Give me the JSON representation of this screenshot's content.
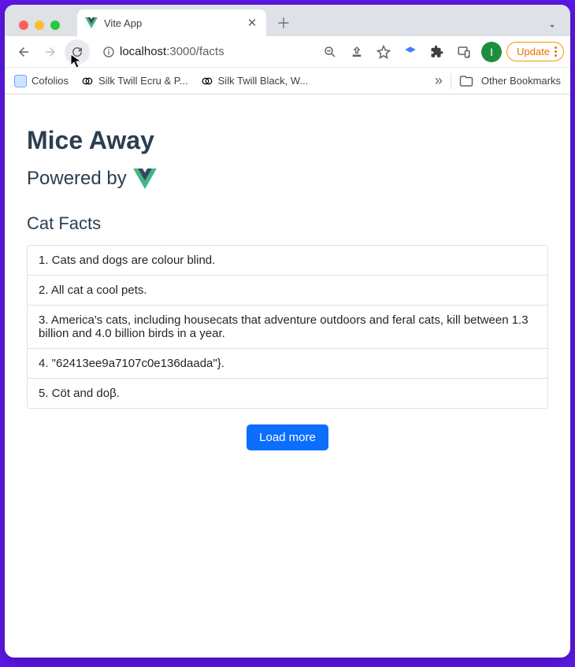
{
  "browser": {
    "tab": {
      "title": "Vite App"
    },
    "url": {
      "host": "localhost",
      "port_and_path": ":3000/facts"
    },
    "update_label": "Update",
    "avatar_letter": "I",
    "bookmarks": [
      {
        "label": "Cofolios"
      },
      {
        "label": "Silk Twill Ecru & P..."
      },
      {
        "label": "Silk Twill Black, W..."
      }
    ],
    "other_bookmarks_label": "Other Bookmarks"
  },
  "page": {
    "title": "Mice Away",
    "subtitle_prefix": "Powered by",
    "section_title": "Cat Facts",
    "load_more_label": "Load more",
    "facts": [
      "Cats and dogs are colour blind.",
      "All cat a cool pets.",
      "America's cats, including housecats that adventure outdoors and feral cats, kill between 1.3 billion and 4.0 billion birds in a year.",
      "\"62413ee9a7107c0e136daada\"}.",
      "Cöt and doβ."
    ]
  }
}
